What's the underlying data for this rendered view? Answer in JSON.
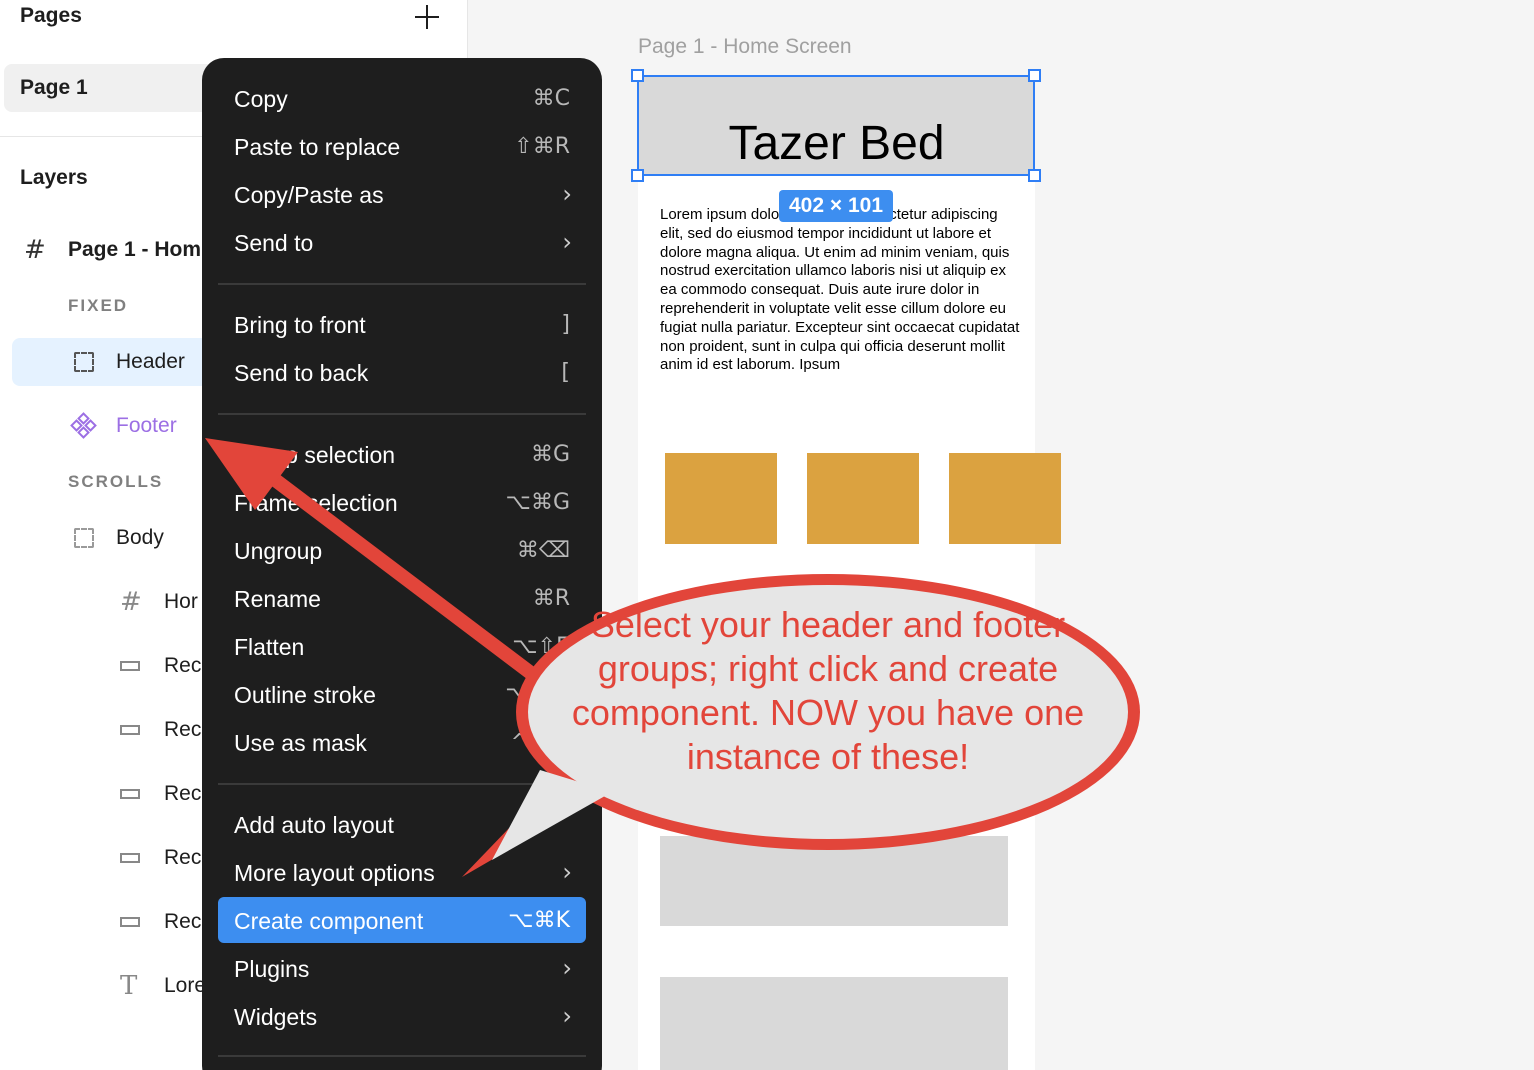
{
  "sidebar": {
    "pages_title": "Pages",
    "add_page_icon": "plus-icon",
    "page_item": "Page 1",
    "layers_title": "Layers",
    "frame_layer": "Page 1 - Hom",
    "section_fixed": "FIXED",
    "header_layer": "Header",
    "footer_layer": "Footer",
    "section_scrolls": "SCROLLS",
    "body_layer": "Body",
    "home_layer": "Hor",
    "rect_layers": [
      "Rec",
      "Rec",
      "Rec",
      "Rec",
      "Rec"
    ],
    "text_layer": "Lore",
    "footer_color": "#9c6fe4"
  },
  "canvas": {
    "frame_title": "Page 1 - Home Screen",
    "header_text": "Tazer Bed",
    "size_badge": "402 × 101",
    "lorem": "Lorem ipsum dolor sit amet, consectetur adipiscing elit, sed do eiusmod tempor incididunt ut labore et dolore magna aliqua. Ut enim ad minim veniam, quis nostrud exercitation ullamco laboris nisi ut aliquip ex ea commodo consequat. Duis aute irure dolor in reprehenderit in voluptate velit esse cillum dolore eu fugiat nulla pariatur. Excepteur sint occaecat cupidatat non proident, sunt in culpa qui officia deserunt mollit anim id est laborum. Ipsum",
    "accent_color": "#dba240",
    "selection_color": "#2f7ef5"
  },
  "context_menu": {
    "items": [
      {
        "label": "Copy",
        "shortcut": "⌘C"
      },
      {
        "label": "Paste to replace",
        "shortcut": "⇧⌘R"
      },
      {
        "label": "Copy/Paste as",
        "submenu": "›"
      },
      {
        "label": "Send to",
        "submenu": "›"
      },
      {
        "label": "Bring to front",
        "shortcut": "]"
      },
      {
        "label": "Send to back",
        "shortcut": "["
      },
      {
        "label": "Group selection",
        "shortcut": "⌘G"
      },
      {
        "label": "Frame selection",
        "shortcut": "⌥⌘G"
      },
      {
        "label": "Ungroup",
        "shortcut": "⌘⌫"
      },
      {
        "label": "Rename",
        "shortcut": "⌘R"
      },
      {
        "label": "Flatten",
        "shortcut": "⌥⇧E"
      },
      {
        "label": "Outline stroke",
        "shortcut": "⌥⌘O"
      },
      {
        "label": "Use as mask",
        "shortcut": "^⌘M"
      },
      {
        "label": "Add auto layout",
        "shortcut": ""
      },
      {
        "label": "More layout options",
        "submenu": "›"
      },
      {
        "label": "Create component",
        "shortcut": "⌥⌘K"
      },
      {
        "label": "Plugins",
        "submenu": "›"
      },
      {
        "label": "Widgets",
        "submenu": "›"
      }
    ],
    "highlight_color": "#3d8ef0"
  },
  "annotation": {
    "text": "Select your header and footer groups; right click and create component. NOW you have one instance of these!",
    "color": "#e2453a"
  }
}
